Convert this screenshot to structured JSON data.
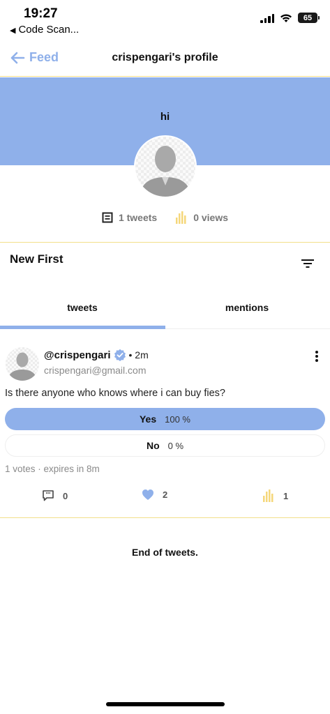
{
  "status_bar": {
    "time": "19:27",
    "back_app": "Code Scan...",
    "battery": "65"
  },
  "header": {
    "back_label": "Feed",
    "title": "crispengari's profile"
  },
  "profile": {
    "bio": "hi",
    "tweets_count": "1 tweets",
    "views_count": "0 views"
  },
  "sort": {
    "label": "New First"
  },
  "tabs": [
    {
      "label": "tweets"
    },
    {
      "label": "mentions"
    }
  ],
  "tweet": {
    "handle": "@crispengari",
    "time": "• 2m",
    "email": "crispengari@gmail.com",
    "text": "Is there anyone who knows where i can buy fies?",
    "poll": {
      "options": [
        {
          "label": "Yes",
          "percent": "100 %"
        },
        {
          "label": "No",
          "percent": "0 %"
        }
      ],
      "meta": "1 votes · expires in 8m"
    },
    "comments": "0",
    "likes": "2",
    "views": "1"
  },
  "footer": {
    "end_text": "End of tweets."
  },
  "colors": {
    "accent": "#8fb0ea",
    "divider": "#f3df8a",
    "views_icon": "#f5d77a"
  }
}
